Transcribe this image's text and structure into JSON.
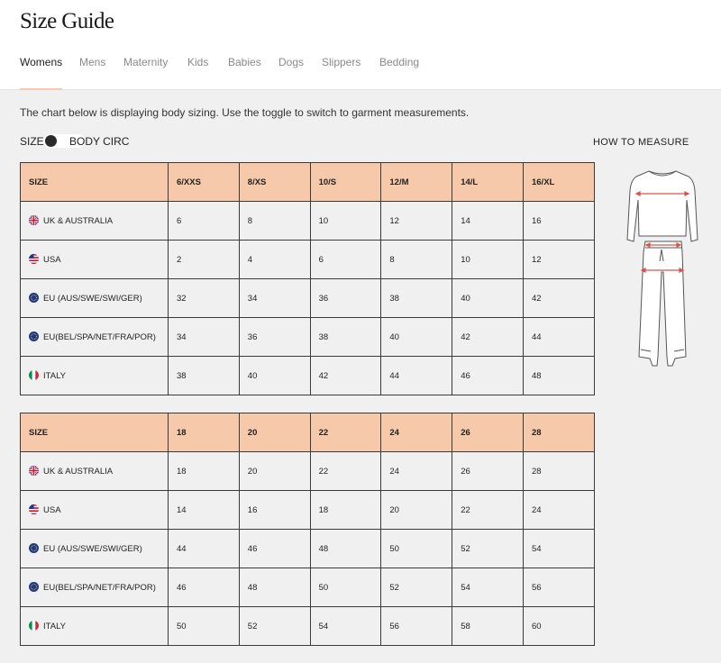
{
  "page": {
    "title": "Size Guide",
    "tabs": [
      {
        "label": "Womens",
        "active": true
      },
      {
        "label": "Mens"
      },
      {
        "label": "Maternity"
      },
      {
        "label": "Kids"
      },
      {
        "label": "Babies"
      },
      {
        "label": "Dogs"
      },
      {
        "label": "Slippers"
      },
      {
        "label": "Bedding"
      }
    ],
    "description": "The chart below is displaying body sizing. Use the toggle to switch to garment measurements.",
    "toggle": {
      "left_label": "SIZE",
      "right_label": "BODY CIRC",
      "state": "off"
    },
    "how_to_measure": "HOW TO MEASURE"
  },
  "tables": [
    {
      "header": [
        "SIZE",
        "6/XXS",
        "8/XS",
        "10/S",
        "12/M",
        "14/L",
        "16/XL"
      ],
      "rows": [
        {
          "region": "UK & AUSTRALIA",
          "flag": "uk-flag-icon",
          "values": [
            "6",
            "8",
            "10",
            "12",
            "14",
            "16"
          ]
        },
        {
          "region": "USA",
          "flag": "us-flag-icon",
          "values": [
            "2",
            "4",
            "6",
            "8",
            "10",
            "12"
          ]
        },
        {
          "region": "EU (AUS/SWE/SWI/GER)",
          "flag": "eu-flag-icon",
          "values": [
            "32",
            "34",
            "36",
            "38",
            "40",
            "42"
          ]
        },
        {
          "region": "EU(BEL/SPA/NET/FRA/POR)",
          "flag": "eu-flag-icon",
          "values": [
            "34",
            "36",
            "38",
            "40",
            "42",
            "44"
          ]
        },
        {
          "region": "ITALY",
          "flag": "italy-flag-icon",
          "values": [
            "38",
            "40",
            "42",
            "44",
            "46",
            "48"
          ]
        }
      ]
    },
    {
      "header": [
        "SIZE",
        "18",
        "20",
        "22",
        "24",
        "26",
        "28"
      ],
      "rows": [
        {
          "region": "UK & AUSTRALIA",
          "flag": "uk-flag-icon",
          "values": [
            "18",
            "20",
            "22",
            "24",
            "26",
            "28"
          ]
        },
        {
          "region": "USA",
          "flag": "us-flag-icon",
          "values": [
            "14",
            "16",
            "18",
            "20",
            "22",
            "24"
          ]
        },
        {
          "region": "EU (AUS/SWE/SWI/GER)",
          "flag": "eu-flag-icon",
          "values": [
            "44",
            "46",
            "48",
            "50",
            "52",
            "54"
          ]
        },
        {
          "region": "EU(BEL/SPA/NET/FRA/POR)",
          "flag": "eu-flag-icon",
          "values": [
            "46",
            "48",
            "50",
            "52",
            "54",
            "56"
          ]
        },
        {
          "region": "ITALY",
          "flag": "italy-flag-icon",
          "values": [
            "50",
            "52",
            "54",
            "56",
            "58",
            "60"
          ]
        }
      ]
    }
  ],
  "colors": {
    "header_fill": "#f5c9aa",
    "tab_underline": "#f5cbb0",
    "background": "#f0f0f0",
    "measure_line": "#d9534f"
  }
}
